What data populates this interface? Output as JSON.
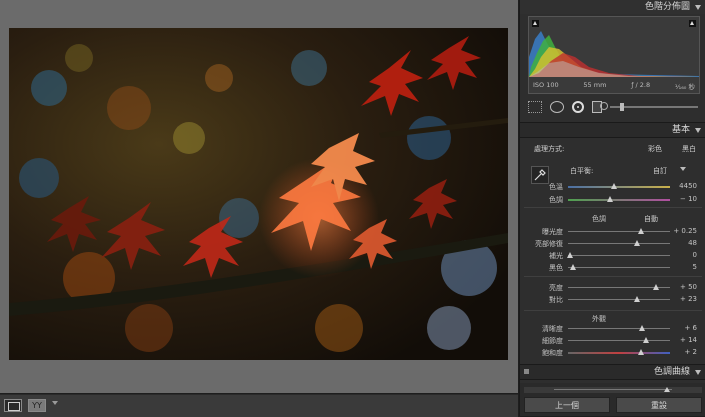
{
  "panel": {
    "histogram_title": "色階分佈圖",
    "histogram_info": {
      "iso": "ISO 100",
      "focal": "55 mm",
      "aperture": "ƒ / 2.8",
      "shutter": "¹⁄₁₆₀ 秒"
    },
    "basic_title": "基本",
    "treatment_label": "處理方式:",
    "treatment_color": "彩色",
    "treatment_bw": "黑白",
    "wb_label": "白平衡:",
    "wb_value": "自訂",
    "tone_label": "色調",
    "tone_auto": "自動",
    "presence_label": "外觀",
    "tone_curve_title": "色調曲線",
    "sliders": [
      {
        "label": "色溫",
        "value": "4450",
        "pos": 0.45
      },
      {
        "label": "色調",
        "value": "− 10",
        "pos": 0.41
      },
      {
        "label": "曝光度",
        "value": "+ 0.25",
        "pos": 0.72
      },
      {
        "label": "亮部修復",
        "value": "48",
        "pos": 0.68
      },
      {
        "label": "補光",
        "value": "0",
        "pos": 0.02
      },
      {
        "label": "黑色",
        "value": "5",
        "pos": 0.05
      },
      {
        "label": "亮度",
        "value": "+ 50",
        "pos": 0.86
      },
      {
        "label": "對比",
        "value": "+ 23",
        "pos": 0.68
      },
      {
        "label": "清晰度",
        "value": "+ 6",
        "pos": 0.73
      },
      {
        "label": "細節度",
        "value": "+ 14",
        "pos": 0.76
      },
      {
        "label": "飽和度",
        "value": "+ 2",
        "pos": 0.72
      }
    ]
  },
  "footer": {
    "previous": "上一個",
    "reset": "重設",
    "compare_label": "YY"
  },
  "colors": {
    "panel_bg": "#2e2e2e",
    "stage_bg": "#6b6b6b",
    "accent": "#cfcfcf"
  },
  "icons": [
    "eyedropper-icon",
    "crop-tool-icon",
    "spot-removal-icon",
    "redeye-icon",
    "graduated-filter-icon",
    "adjustment-brush-icon",
    "loupe-view-icon",
    "compare-view-icon",
    "collapse-triangle-icon"
  ]
}
